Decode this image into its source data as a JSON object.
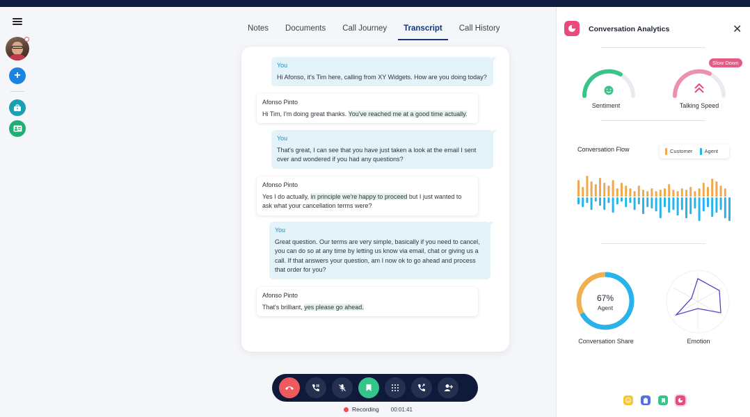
{
  "tabs": [
    {
      "label": "Notes"
    },
    {
      "label": "Documents"
    },
    {
      "label": "Call Journey"
    },
    {
      "label": "Transcript",
      "active": true
    },
    {
      "label": "Call History"
    }
  ],
  "transcript": {
    "messages": [
      {
        "speaker": "You",
        "role": "agent",
        "text": "Hi Afonso, it's Tim here, calling from XY Widgets. How are you doing today?"
      },
      {
        "speaker": "Afonso Pinto",
        "role": "customer",
        "text_before": "Hi Tim, I'm doing great thanks. ",
        "highlight": "You've reached me at a good time actually.",
        "text_after": ""
      },
      {
        "speaker": "You",
        "role": "agent",
        "text": "That's great, I can see that you have just taken a look at the email I sent over and wondered if you had any questions?"
      },
      {
        "speaker": "Afonso Pinto",
        "role": "customer",
        "text_before": "Yes I do actually, ",
        "highlight": "in principle we're happy to proceed",
        "text_after": " but I just wanted to ask what your cancellation terms were?"
      },
      {
        "speaker": "You",
        "role": "agent",
        "text": "Great question. Our terms are very simple, basically if you need to cancel, you can do so at any time by letting us know via email, chat or giving us a call. If that answers your question, am I now ok to go ahead and process that order for you?"
      },
      {
        "speaker": "Afonso Pinto",
        "role": "customer",
        "text_before": "That's brilliant, ",
        "highlight": "yes please go ahead.",
        "text_after": ""
      }
    ]
  },
  "call": {
    "recording_label": "Recording",
    "timer": "00:01:41"
  },
  "analytics": {
    "title": "Conversation Analytics",
    "sentiment_label": "Sentiment",
    "speed_label": "Talking Speed",
    "speed_badge": "Slow Down",
    "flow_title": "Conversation Flow",
    "legend_customer": "Customer",
    "legend_agent": "Agent",
    "share_percent": "67%",
    "share_sub": "Agent",
    "share_label": "Conversation Share",
    "emotion_label": "Emotion",
    "share_agent_fraction": 0.67,
    "colors": {
      "customer": "#f0a84c",
      "agent": "#27b4ec",
      "sentiment": "#3bc48a",
      "speed": "#e84a7b"
    },
    "flow": {
      "customer": [
        24,
        14,
        30,
        22,
        18,
        27,
        20,
        16,
        24,
        12,
        20,
        16,
        12,
        8,
        16,
        10,
        8,
        12,
        8,
        10,
        12,
        18,
        10,
        8,
        12,
        10,
        14,
        8,
        12,
        20,
        14,
        26,
        22,
        16,
        12,
        0
      ],
      "agent": [
        10,
        14,
        8,
        18,
        6,
        12,
        18,
        8,
        22,
        10,
        6,
        14,
        8,
        18,
        10,
        24,
        14,
        16,
        20,
        30,
        14,
        22,
        18,
        26,
        18,
        30,
        24,
        16,
        34,
        20,
        14,
        28,
        22,
        18,
        30,
        34
      ]
    }
  }
}
